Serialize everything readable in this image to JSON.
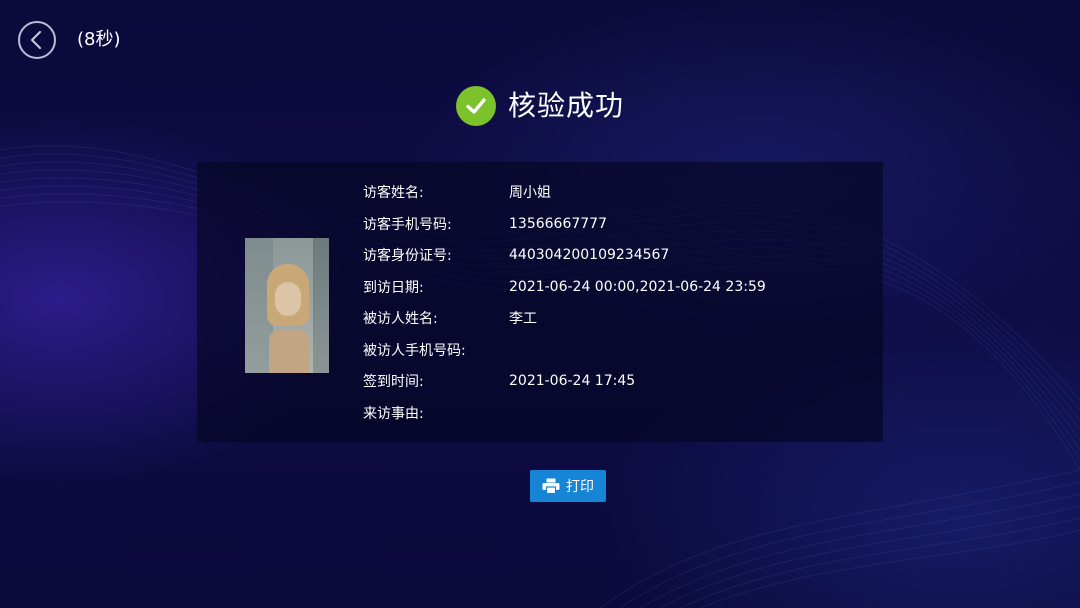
{
  "header": {
    "back_icon": "chevron-left-icon",
    "countdown": "(8秒)"
  },
  "result": {
    "icon": "check-circle-icon",
    "title": "核验成功",
    "accent_color": "#7cc22a"
  },
  "visitor": {
    "photo_label": "visitor-photo",
    "fields": [
      {
        "label": "访客姓名:",
        "value": "周小姐"
      },
      {
        "label": "访客手机号码:",
        "value": "13566667777"
      },
      {
        "label": "访客身份证号:",
        "value": "440304200109234567"
      },
      {
        "label": "到访日期:",
        "value": "2021-06-24 00:00,2021-06-24 23:59"
      },
      {
        "label": "被访人姓名:",
        "value": "李工"
      },
      {
        "label": "被访人手机号码:",
        "value": ""
      },
      {
        "label": "签到时间:",
        "value": "2021-06-24 17:45"
      },
      {
        "label": "来访事由:",
        "value": ""
      }
    ]
  },
  "actions": {
    "print_icon": "printer-icon",
    "print_label": "打印",
    "print_color": "#1685d6"
  }
}
